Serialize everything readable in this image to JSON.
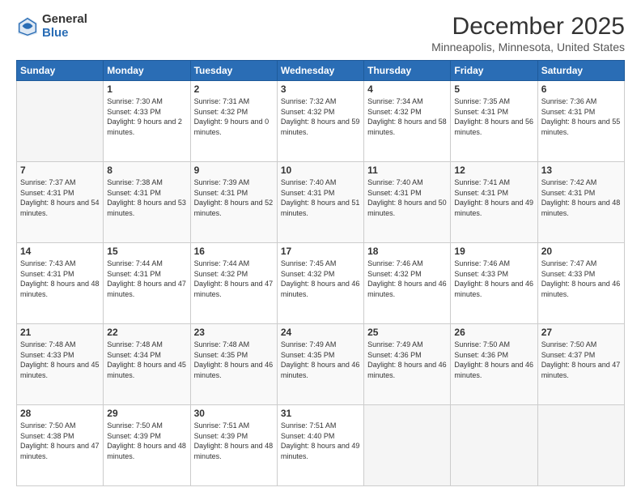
{
  "logo": {
    "general": "General",
    "blue": "Blue"
  },
  "header": {
    "month": "December 2025",
    "location": "Minneapolis, Minnesota, United States"
  },
  "weekdays": [
    "Sunday",
    "Monday",
    "Tuesday",
    "Wednesday",
    "Thursday",
    "Friday",
    "Saturday"
  ],
  "weeks": [
    [
      {
        "day": "",
        "empty": true
      },
      {
        "day": "1",
        "sunrise": "7:30 AM",
        "sunset": "4:33 PM",
        "daylight": "9 hours and 2 minutes."
      },
      {
        "day": "2",
        "sunrise": "7:31 AM",
        "sunset": "4:32 PM",
        "daylight": "9 hours and 0 minutes."
      },
      {
        "day": "3",
        "sunrise": "7:32 AM",
        "sunset": "4:32 PM",
        "daylight": "8 hours and 59 minutes."
      },
      {
        "day": "4",
        "sunrise": "7:34 AM",
        "sunset": "4:32 PM",
        "daylight": "8 hours and 58 minutes."
      },
      {
        "day": "5",
        "sunrise": "7:35 AM",
        "sunset": "4:31 PM",
        "daylight": "8 hours and 56 minutes."
      },
      {
        "day": "6",
        "sunrise": "7:36 AM",
        "sunset": "4:31 PM",
        "daylight": "8 hours and 55 minutes."
      }
    ],
    [
      {
        "day": "7",
        "sunrise": "7:37 AM",
        "sunset": "4:31 PM",
        "daylight": "8 hours and 54 minutes."
      },
      {
        "day": "8",
        "sunrise": "7:38 AM",
        "sunset": "4:31 PM",
        "daylight": "8 hours and 53 minutes."
      },
      {
        "day": "9",
        "sunrise": "7:39 AM",
        "sunset": "4:31 PM",
        "daylight": "8 hours and 52 minutes."
      },
      {
        "day": "10",
        "sunrise": "7:40 AM",
        "sunset": "4:31 PM",
        "daylight": "8 hours and 51 minutes."
      },
      {
        "day": "11",
        "sunrise": "7:40 AM",
        "sunset": "4:31 PM",
        "daylight": "8 hours and 50 minutes."
      },
      {
        "day": "12",
        "sunrise": "7:41 AM",
        "sunset": "4:31 PM",
        "daylight": "8 hours and 49 minutes."
      },
      {
        "day": "13",
        "sunrise": "7:42 AM",
        "sunset": "4:31 PM",
        "daylight": "8 hours and 48 minutes."
      }
    ],
    [
      {
        "day": "14",
        "sunrise": "7:43 AM",
        "sunset": "4:31 PM",
        "daylight": "8 hours and 48 minutes."
      },
      {
        "day": "15",
        "sunrise": "7:44 AM",
        "sunset": "4:31 PM",
        "daylight": "8 hours and 47 minutes."
      },
      {
        "day": "16",
        "sunrise": "7:44 AM",
        "sunset": "4:32 PM",
        "daylight": "8 hours and 47 minutes."
      },
      {
        "day": "17",
        "sunrise": "7:45 AM",
        "sunset": "4:32 PM",
        "daylight": "8 hours and 46 minutes."
      },
      {
        "day": "18",
        "sunrise": "7:46 AM",
        "sunset": "4:32 PM",
        "daylight": "8 hours and 46 minutes."
      },
      {
        "day": "19",
        "sunrise": "7:46 AM",
        "sunset": "4:33 PM",
        "daylight": "8 hours and 46 minutes."
      },
      {
        "day": "20",
        "sunrise": "7:47 AM",
        "sunset": "4:33 PM",
        "daylight": "8 hours and 46 minutes."
      }
    ],
    [
      {
        "day": "21",
        "sunrise": "7:48 AM",
        "sunset": "4:33 PM",
        "daylight": "8 hours and 45 minutes."
      },
      {
        "day": "22",
        "sunrise": "7:48 AM",
        "sunset": "4:34 PM",
        "daylight": "8 hours and 45 minutes."
      },
      {
        "day": "23",
        "sunrise": "7:48 AM",
        "sunset": "4:35 PM",
        "daylight": "8 hours and 46 minutes."
      },
      {
        "day": "24",
        "sunrise": "7:49 AM",
        "sunset": "4:35 PM",
        "daylight": "8 hours and 46 minutes."
      },
      {
        "day": "25",
        "sunrise": "7:49 AM",
        "sunset": "4:36 PM",
        "daylight": "8 hours and 46 minutes."
      },
      {
        "day": "26",
        "sunrise": "7:50 AM",
        "sunset": "4:36 PM",
        "daylight": "8 hours and 46 minutes."
      },
      {
        "day": "27",
        "sunrise": "7:50 AM",
        "sunset": "4:37 PM",
        "daylight": "8 hours and 47 minutes."
      }
    ],
    [
      {
        "day": "28",
        "sunrise": "7:50 AM",
        "sunset": "4:38 PM",
        "daylight": "8 hours and 47 minutes."
      },
      {
        "day": "29",
        "sunrise": "7:50 AM",
        "sunset": "4:39 PM",
        "daylight": "8 hours and 48 minutes."
      },
      {
        "day": "30",
        "sunrise": "7:51 AM",
        "sunset": "4:39 PM",
        "daylight": "8 hours and 48 minutes."
      },
      {
        "day": "31",
        "sunrise": "7:51 AM",
        "sunset": "4:40 PM",
        "daylight": "8 hours and 49 minutes."
      },
      {
        "day": "",
        "empty": true
      },
      {
        "day": "",
        "empty": true
      },
      {
        "day": "",
        "empty": true
      }
    ]
  ]
}
